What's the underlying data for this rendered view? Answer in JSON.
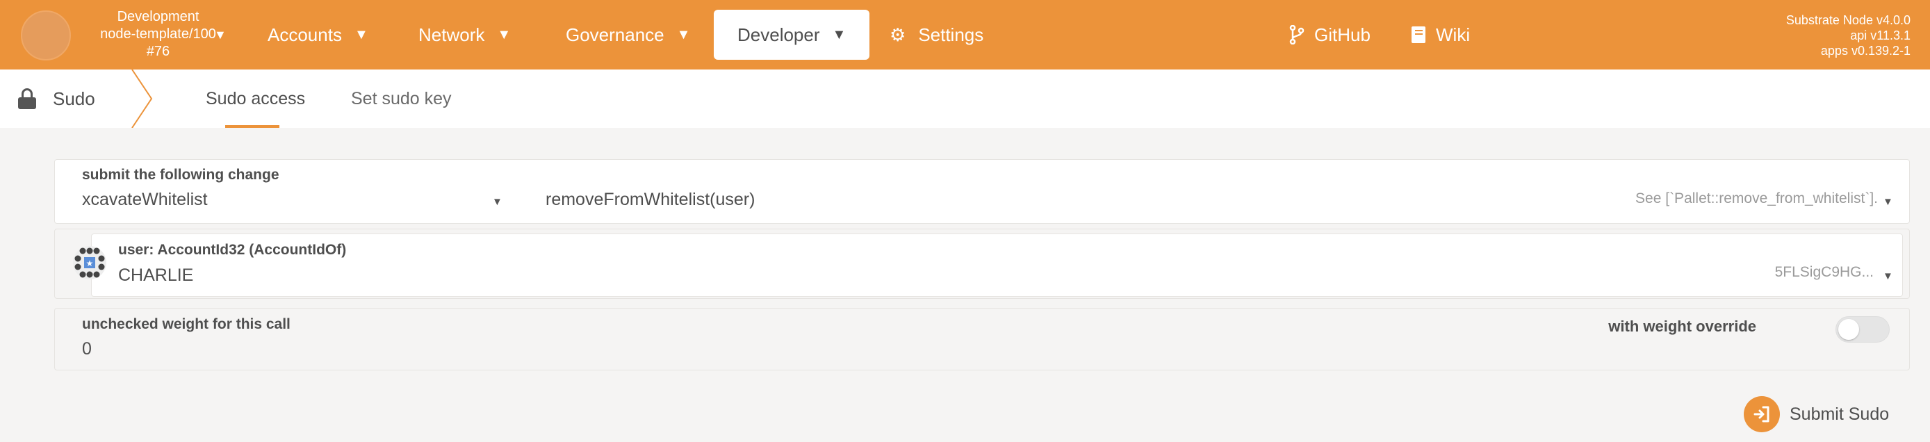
{
  "header": {
    "chain": {
      "name": "Development",
      "runtime": "node-template/100",
      "block": "#76"
    },
    "nav": [
      {
        "label": "Accounts",
        "icon": "chevron-down-icon"
      },
      {
        "label": "Network",
        "icon": "chevron-down-icon"
      },
      {
        "label": "Governance",
        "icon": "chevron-down-icon"
      },
      {
        "label": "Developer",
        "icon": "chevron-down-icon",
        "active": true
      },
      {
        "label": "Settings",
        "icon": "gears-icon"
      },
      {
        "label": "GitHub",
        "icon": "code-branch-icon"
      },
      {
        "label": "Wiki",
        "icon": "book-icon"
      }
    ],
    "version": {
      "node": "Substrate Node v4.0.0",
      "api": "api v11.3.1",
      "apps": "apps v0.139.2-1"
    }
  },
  "subnav": {
    "title": "Sudo",
    "tabs": [
      {
        "label": "Sudo access",
        "active": true
      },
      {
        "label": "Set sudo key",
        "active": false
      }
    ]
  },
  "change": {
    "label": "submit the following change",
    "pallet": "xcavateWhitelist",
    "call": "removeFromWhitelist(user)",
    "doc": "See [`Pallet::remove_from_whitelist`]."
  },
  "user": {
    "label": "user: AccountId32 (AccountIdOf)",
    "name": "CHARLIE",
    "address": "5FLSigC9HG..."
  },
  "weight": {
    "label": "unchecked weight for this call",
    "value": "0",
    "override_label": "with weight override",
    "override_enabled": false
  },
  "submit": {
    "label": "Submit Sudo",
    "icon": "sign-in-icon"
  },
  "colors": {
    "accent": "#ec933a",
    "background": "#f5f4f3"
  }
}
